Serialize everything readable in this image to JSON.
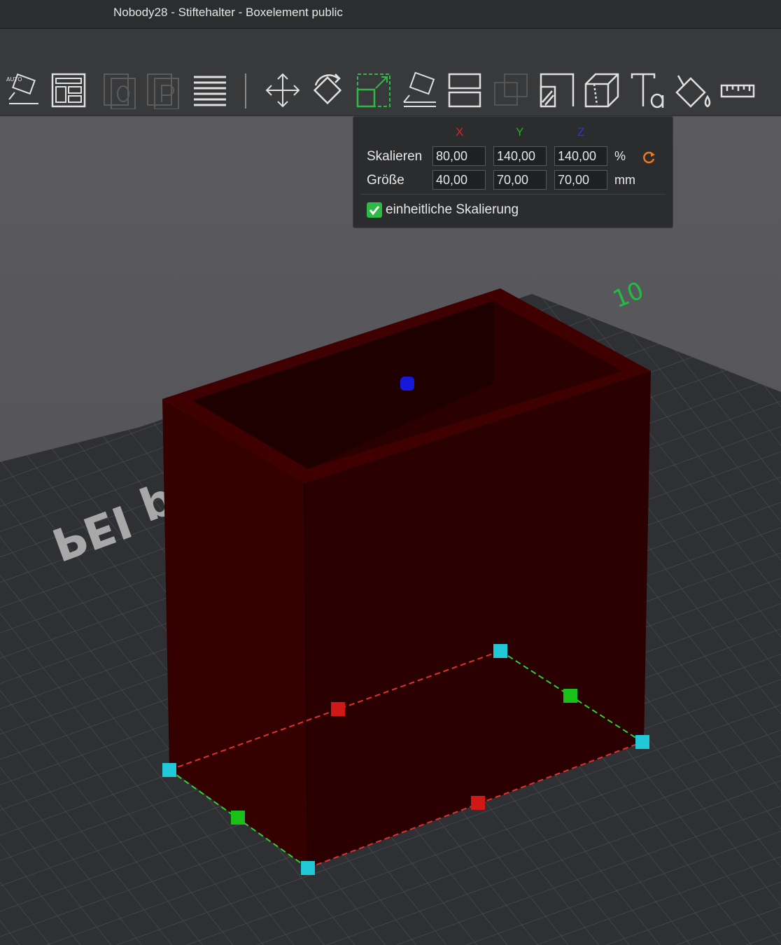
{
  "window": {
    "title": "Nobody28 - Stiftehalter - Boxelement public"
  },
  "toolbar": {
    "tools": [
      "auto-arrange-icon",
      "layout-icon",
      "copy-icon",
      "paste-icon",
      "layers-icon",
      "move-icon",
      "rotate-icon",
      "scale-icon",
      "place-on-face-icon",
      "cut-icon",
      "boolean-icon",
      "support-paint-icon",
      "seam-paint-icon",
      "text-icon",
      "color-paint-icon",
      "measure-icon"
    ],
    "auto_label": "AUTO"
  },
  "scale_panel": {
    "axes": {
      "x": "X",
      "y": "Y",
      "z": "Z"
    },
    "axis_colors": {
      "x": "#e02020",
      "y": "#20b020",
      "z": "#3030e0"
    },
    "scale": {
      "label": "Skalieren",
      "x": "80,00",
      "y": "140,00",
      "z": "140,00",
      "unit": "%"
    },
    "size": {
      "label": "Größe",
      "x": "40,00",
      "y": "70,00",
      "z": "70,00",
      "unit": "mm"
    },
    "uniform": {
      "label": "einheitliche Skalierung",
      "checked": true
    }
  },
  "viewport": {
    "plate_text": "PEI pad",
    "plate_mark": "10",
    "model_color": "#3a0000"
  }
}
